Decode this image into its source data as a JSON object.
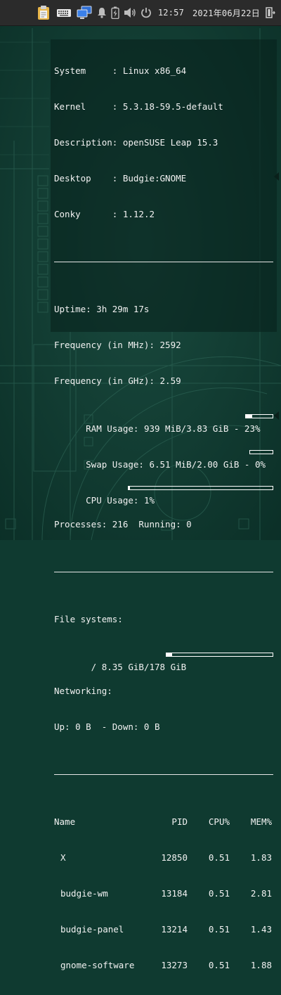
{
  "panel": {
    "time": "12:57",
    "date": "2021年06月22日",
    "icons": [
      "clipboard-icon",
      "keyboard-icon",
      "network-icon",
      "notification-bell-icon",
      "battery-icon",
      "volume-icon",
      "power-icon"
    ]
  },
  "conky": {
    "system_info": [
      {
        "label": "System     :",
        "value": "Linux x86_64"
      },
      {
        "label": "Kernel     :",
        "value": "5.3.18-59.5-default"
      },
      {
        "label": "Description:",
        "value": "openSUSE Leap 15.3"
      },
      {
        "label": "Desktop    :",
        "value": "Budgie:GNOME"
      },
      {
        "label": "Conky      :",
        "value": "1.12.2"
      }
    ],
    "stats": {
      "uptime": "Uptime: 3h 29m 17s",
      "freq_mhz": "Frequency (in MHz): 2592",
      "freq_ghz": "Frequency (in GHz): 2.59",
      "ram": "RAM Usage: 939 MiB/3.83 GiB - 23%",
      "ram_percent": 23,
      "swap": "Swap Usage: 6.51 MiB/2.00 GiB - 0%",
      "swap_percent": 0,
      "cpu": "CPU Usage: 1%",
      "cpu_percent": 1,
      "processes": "Processes: 216  Running: 0"
    },
    "filesystems": {
      "heading": "File systems:",
      "root": " / 8.35 GiB/178 GiB",
      "root_percent": 5,
      "net_heading": "Networking:",
      "net": "Up: 0 B  - Down: 0 B"
    },
    "processes": {
      "headers": {
        "name": "Name",
        "pid": "PID",
        "cpu": "CPU%",
        "mem": "MEM%"
      },
      "rows": [
        {
          "name": "X",
          "pid": "12850",
          "cpu": "0.51",
          "mem": "1.83"
        },
        {
          "name": "budgie-wm",
          "pid": "13184",
          "cpu": "0.51",
          "mem": "2.81"
        },
        {
          "name": "budgie-panel",
          "pid": "13214",
          "cpu": "0.51",
          "mem": "1.43"
        },
        {
          "name": "gnome-software",
          "pid": "13273",
          "cpu": "0.51",
          "mem": "1.88"
        }
      ]
    }
  }
}
